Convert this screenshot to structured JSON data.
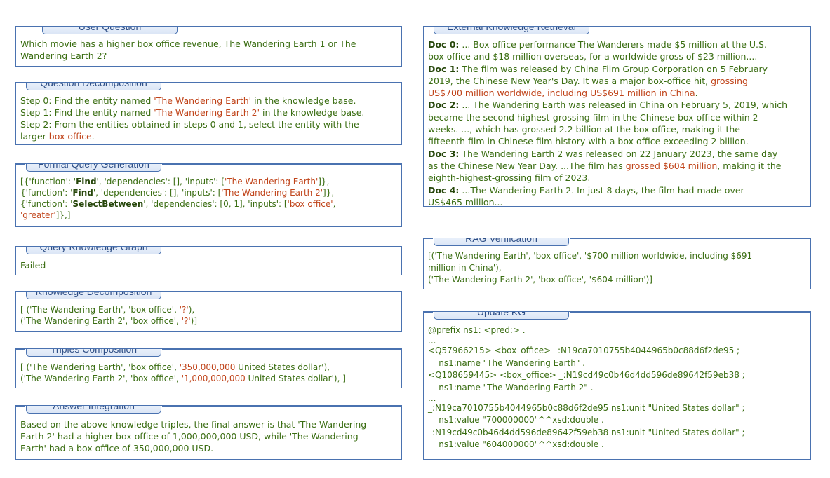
{
  "left": {
    "user_question": {
      "title": "User Question",
      "lines": [
        "Which movie has a higher box office revenue, The Wandering Earth 1 or The",
        "Wandering Earth 2?"
      ]
    },
    "question_decomposition": {
      "title": "Question Decomposition",
      "l1a": "Step 0: Find the entity named ",
      "l1b": "'The Wandering Earth'",
      "l1c": " in the knowledge base.",
      "l2a": "Step 1: Find the entity named ",
      "l2b": "'The Wandering Earth 2'",
      "l2c": " in the knowledge base.",
      "l3": "Step 2: From the entities obtained in steps 0 and 1, select the entity with the",
      "l4a": "larger ",
      "l4b": "box office",
      "l4c": "."
    },
    "formal_query": {
      "title": "Formal Query Generation",
      "l1a": "[{'function': '",
      "l1b": "Find",
      "l1c": "', 'dependencies': [], 'inputs': [",
      "l1d": "'The Wandering Earth'",
      "l1e": "]},",
      "l2a": "{'function': '",
      "l2b": "Find",
      "l2c": "', 'dependencies': [], 'inputs': [",
      "l2d": "'The Wandering Earth 2'",
      "l2e": "]},",
      "l3a": "{'function': '",
      "l3b": "SelectBetween",
      "l3c": "', 'dependencies': [0, 1], 'inputs': [",
      "l3d": "'box office'",
      "l3e": ",",
      "l4a": "'greater'",
      "l4b": "]},]"
    },
    "query_kg": {
      "title": "Query Knowledge Graph",
      "text": "Failed"
    },
    "knowledge_decomposition": {
      "title": "Knowledge Decomposition",
      "l1a": "[ ('The Wandering Earth', 'box office', ",
      "l1b": "'?'",
      "l1c": "),",
      "l2a": "('The Wandering Earth 2', 'box office', ",
      "l2b": "'?'",
      "l2c": ")]"
    },
    "triples_composition": {
      "title": "Triples Composition",
      "l1a": "[ ('The Wandering Earth', 'box office', ",
      "l1b": "'350,000,000",
      "l1c": " United States dollar'),",
      "l2a": "('The Wandering Earth 2', 'box office', ",
      "l2b": "'1,000,000,000",
      "l2c": " United States dollar'), ]"
    },
    "answer_integration": {
      "title": "Answer Integration",
      "lines": [
        "Based on the above knowledge triples, the final answer is that 'The Wandering",
        "Earth 2' had a higher box office of 1,000,000,000 USD, while 'The Wandering",
        "Earth' had a box office of 350,000,000 USD."
      ]
    }
  },
  "right": {
    "retrieval": {
      "title": "External Knowledge Retrieval",
      "d0": "Doc 0:",
      "d0l1": " ... Box office performance The Wanderers made $5 million at the U.S.",
      "d0l2": "box office and $18 million overseas, for a worldwide gross of $23 million....",
      "d1": "Doc 1:",
      "d1l1": " The film was released by China Film Group Corporation on 5 February",
      "d1l2a": "2019, the Chinese New Year's Day. It was a major box-office hit, ",
      "d1l2b": "grossing",
      "d1l3": "US$700 million worldwide, including US$691 million in China",
      "d1l3c": ".",
      "d2": "Doc 2:",
      "d2l1": " ... The Wandering Earth was released in China on February 5, 2019, which",
      "d2l2": "became the second highest-grossing film in the Chinese box office within 2",
      "d2l3": "weeks. ..., which has grossed 2.2 billion at the box office, making it the",
      "d2l4": "fifteenth film in Chinese film history with a box office exceeding 2 billion.",
      "d3": "Doc 3:",
      "d3l1": " The Wandering Earth 2 was released on 22 January 2023, the same day",
      "d3l2a": "as the Chinese New Year Day. ...The film has ",
      "d3l2b": "grossed $604 million",
      "d3l2c": ", making it the",
      "d3l3": "eighth-highest-grossing film of 2023.",
      "d4": "Doc 4:",
      "d4l1": " ...The Wandering Earth 2. In just 8 days, the film had made over",
      "d4l2": "US$465 million..."
    },
    "rag": {
      "title": "RAG Verification",
      "lines": [
        "[('The Wandering Earth', 'box office', '$700 million worldwide, including $691",
        "million in China'),",
        "('The Wandering Earth 2', 'box office', '$604 million')]"
      ]
    },
    "update_kg": {
      "title": "Update KG",
      "lines": [
        "@prefix ns1: <pred:> .",
        "...",
        "<Q57966215> <box_office> _:N19ca7010755b4044965b0c88d6f2de95 ;",
        "    ns1:name \"The Wandering Earth\" .",
        "<Q108659445> <box_office> _:N19cd49c0b46d4dd596de89642f59eb38 ;",
        "    ns1:name \"The Wandering Earth 2\" .",
        "...",
        "_:N19ca7010755b4044965b0c88d6f2de95 ns1:unit \"United States dollar\" ;",
        "    ns1:value \"700000000\"^^xsd:double .",
        "_:N19cd49c0b46d4dd596de89642f59eb38 ns1:unit \"United States dollar\" ;",
        "    ns1:value \"604000000\"^^xsd:double ."
      ]
    }
  }
}
